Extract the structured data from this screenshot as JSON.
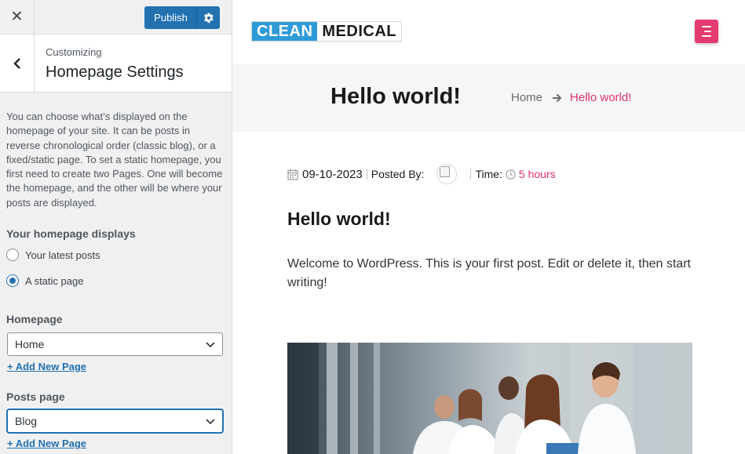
{
  "customizer": {
    "close_icon": "close-icon",
    "publish_label": "Publish",
    "settings_icon": "gear-icon",
    "back_icon": "chevron-left-icon",
    "customizing_label": "Customizing",
    "section_title": "Homepage Settings",
    "description": "You can choose what’s displayed on the homepage of your site. It can be posts in reverse chronological order (classic blog), or a fixed/static page. To set a static homepage, you first need to create two Pages. One will become the homepage, and the other will be where your posts are displayed.",
    "displays_label": "Your homepage displays",
    "options": [
      {
        "label": "Your latest posts",
        "checked": false
      },
      {
        "label": "A static page",
        "checked": true
      }
    ],
    "homepage_label": "Homepage",
    "homepage_value": "Home",
    "add_new_page_1": "+ Add New Page",
    "posts_page_label": "Posts page",
    "posts_page_value": "Blog",
    "add_new_page_2": "+ Add New Page",
    "accent_color": "#2271b1"
  },
  "preview": {
    "logo_part_1": "CLEAN",
    "logo_part_2": "MEDICAL",
    "logo_color": "#2e9ad8",
    "menu_icon": "hamburger-menu-icon",
    "accent_color": "#e3326c",
    "banner_title": "Hello world!",
    "breadcrumb": {
      "home": "Home",
      "current": "Hello world!"
    },
    "meta": {
      "date": "09-10-2023",
      "posted_by_label": "Posted By:",
      "time_label": "Time:",
      "time_value": "5 hours"
    },
    "post_title": "Hello world!",
    "post_text": "Welcome to WordPress. This is your first post. Edit or delete it, then start writing!",
    "image_subject": "medical-team-photo"
  }
}
